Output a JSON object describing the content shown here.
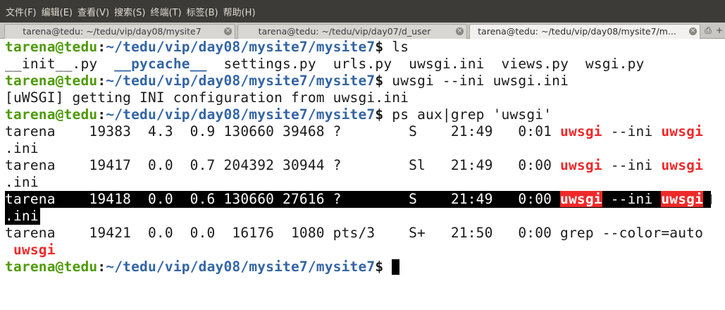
{
  "menubar": {
    "items": [
      "文件(F)",
      "编辑(E)",
      "查看(V)",
      "搜索(S)",
      "终端(T)",
      "标签(B)",
      "帮助(H)"
    ]
  },
  "tabs": [
    {
      "label": "tarena@tedu: ~/tedu/vip/day08/mysite7",
      "active": false
    },
    {
      "label": "tarena@tedu: ~/tedu/vip/day07/d_user",
      "active": false
    },
    {
      "label": "tarena@tedu: ~/tedu/vip/day08/mysite7/m...",
      "active": true
    }
  ],
  "prompt": {
    "user_host": "tarena@tedu",
    "path": "~/tedu/vip/day08/mysite7/mysite7",
    "symbol": "$"
  },
  "commands": {
    "ls": " ls",
    "uwsgi": " uwsgi --ini uwsgi.ini",
    "ps": " ps aux|grep 'uwsgi'"
  },
  "ls_output": {
    "init": "__init__.py",
    "pycache": "__pycache__",
    "rest": "settings.py  urls.py  uwsgi.ini  views.py  wsgi.py"
  },
  "uwsgi_output": "[uWSGI] getting INI configuration from uwsgi.ini",
  "ps_rows": [
    {
      "prefix": "tarena    19383  4.3  0.9 130660 39468 ?        S    21:49   0:01 ",
      "m1": "uwsgi",
      "mid": " --ini ",
      "m2": "uwsgi",
      "cont": ".ini",
      "selected": false
    },
    {
      "prefix": "tarena    19417  0.0  0.7 204392 30944 ?        Sl   21:49   0:00 ",
      "m1": "uwsgi",
      "mid": " --ini ",
      "m2": "uwsgi",
      "cont": ".ini",
      "selected": false
    },
    {
      "prefix": "tarena    19418  0.0  0.6 130660 27616 ?        S    21:49   0:00 ",
      "m1": "uwsgi",
      "mid": " --ini ",
      "m2": "uwsgi",
      "cont": ".ini",
      "selected": true
    }
  ],
  "grep_row": {
    "prefix": "tarena    19421  0.0  0.0  16176  1080 pts/3    S+   21:50   0:00 grep --color=auto",
    "cont": "uwsgi"
  },
  "colors": {
    "prompt_user": "#4e9a06",
    "prompt_path": "#3465a4",
    "match": "#ef2929",
    "menubar_bg": "#3c3b37"
  }
}
